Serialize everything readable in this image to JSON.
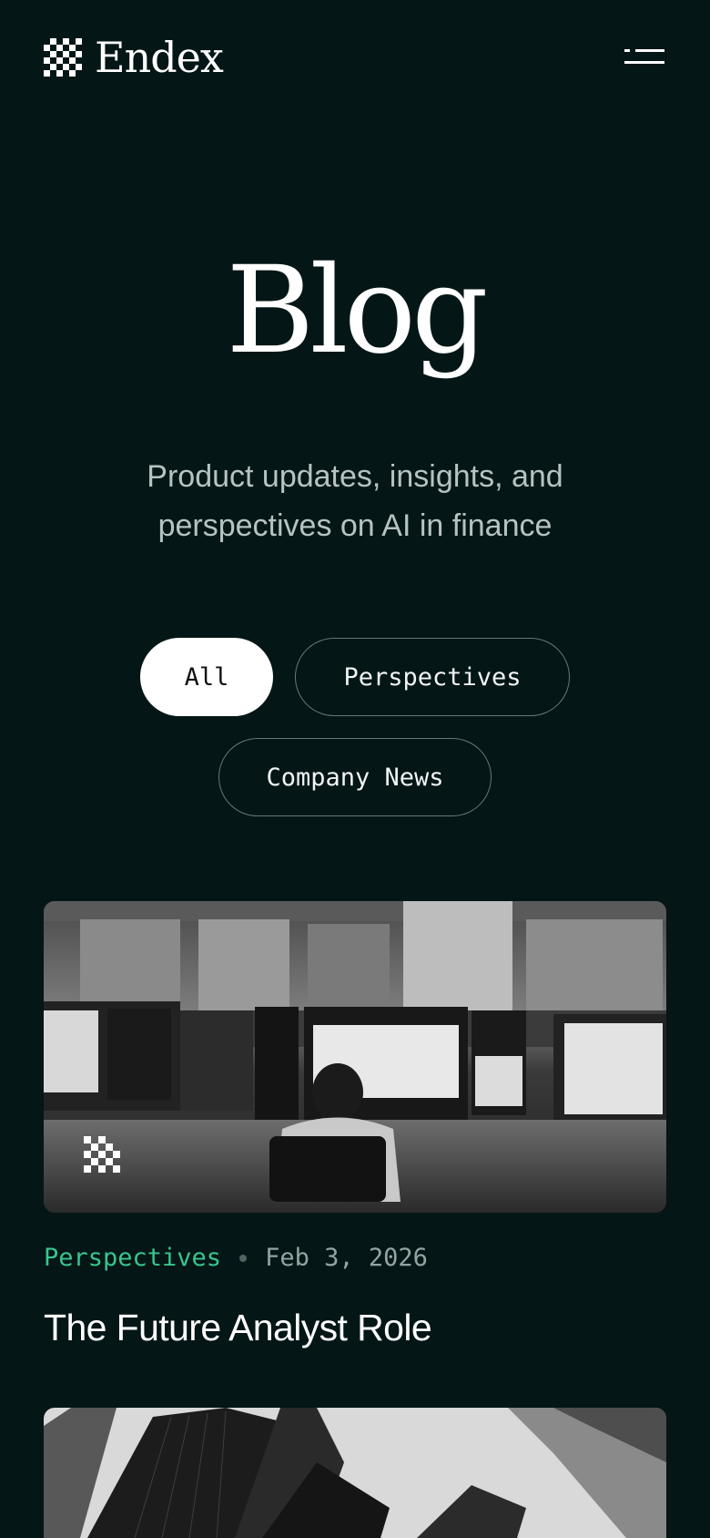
{
  "header": {
    "brand": "Endex",
    "icons": {
      "logo": "checkerboard-logo-icon",
      "menu": "menu-icon"
    }
  },
  "hero": {
    "title": "Blog",
    "subtitle": "Product updates, insights, and perspectives on AI in finance"
  },
  "filters": {
    "items": [
      {
        "label": "All",
        "active": true
      },
      {
        "label": "Perspectives",
        "active": false
      },
      {
        "label": "Company News",
        "active": false
      }
    ]
  },
  "posts": [
    {
      "category": "Perspectives",
      "date": "Feb 3, 2026",
      "title": "The Future Analyst Role"
    }
  ],
  "colors": {
    "background": "#041616",
    "accent": "#39c58f",
    "muted": "#95a3a3",
    "subtitle": "#b7c2c2"
  }
}
